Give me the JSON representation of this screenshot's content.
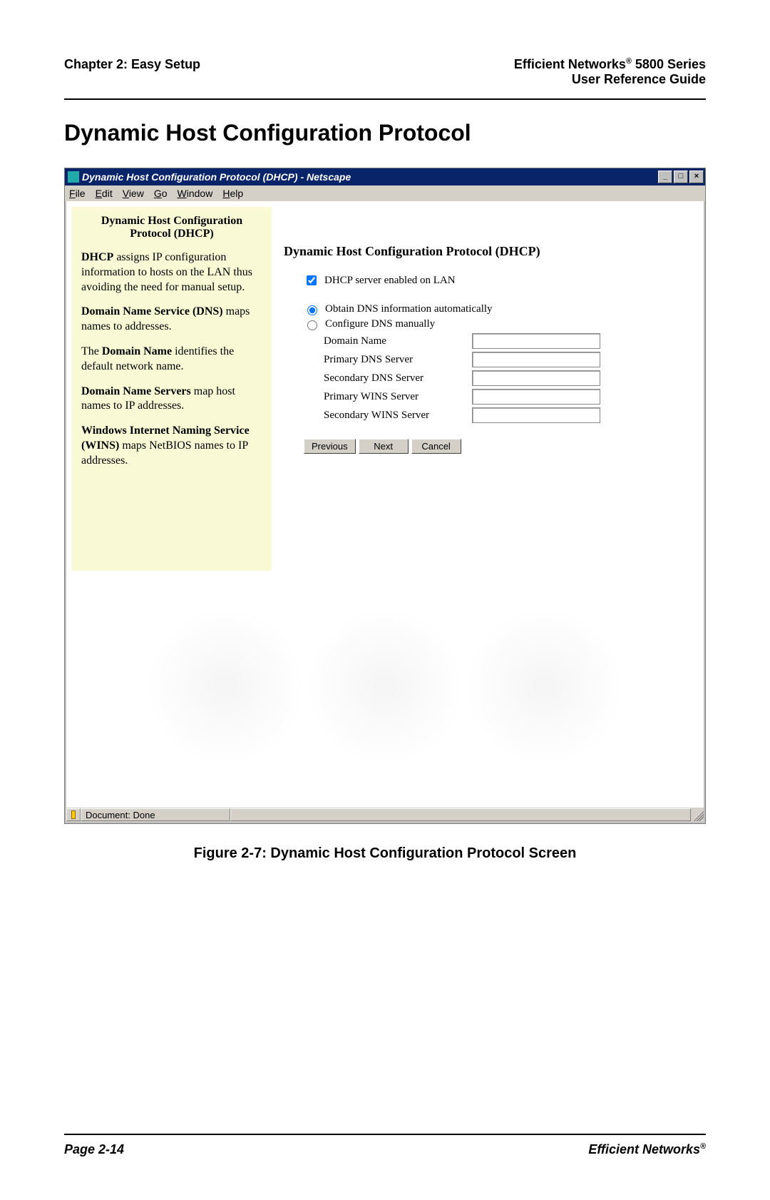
{
  "header": {
    "chapter": "Chapter 2: Easy Setup",
    "product_line1": "Efficient Networks",
    "product_reg": "®",
    "product_series": " 5800 Series",
    "product_line2": "User Reference Guide"
  },
  "section_title": "Dynamic Host Configuration Protocol",
  "window": {
    "title": "Dynamic Host Configuration Protocol (DHCP) - Netscape",
    "menus": {
      "file": "File",
      "edit": "Edit",
      "view": "View",
      "go": "Go",
      "window": "Window",
      "help": "Help"
    },
    "win_min": "_",
    "win_max": "□",
    "win_close": "×"
  },
  "sidebar": {
    "title": "Dynamic Host Configuration Protocol (DHCP)",
    "p1a": "DHCP",
    "p1b": " assigns IP configuration information to hosts on the LAN thus avoiding the need for manual setup.",
    "p2a": "Domain Name Service (DNS)",
    "p2b": " maps names to addresses.",
    "p3a": "The ",
    "p3b": "Domain Name",
    "p3c": " identifies the default network name.",
    "p4a": "Domain Name Servers",
    "p4b": " map host names to IP addresses.",
    "p5a": "Windows Internet Naming Service (WINS)",
    "p5b": " maps NetBIOS names to IP addresses."
  },
  "form": {
    "heading": "Dynamic Host Configuration Protocol (DHCP)",
    "chk_label": "DHCP server enabled on LAN",
    "radio1": "Obtain DNS information automatically",
    "radio2": "Configure DNS manually",
    "domain_name": "Domain Name",
    "primary_dns": "Primary DNS Server",
    "secondary_dns": "Secondary DNS Server",
    "primary_wins": "Primary WINS Server",
    "secondary_wins": "Secondary WINS Server",
    "values": {
      "domain_name": "",
      "primary_dns": "",
      "secondary_dns": "",
      "primary_wins": "",
      "secondary_wins": ""
    },
    "btn_previous": "Previous",
    "btn_next": "Next",
    "btn_cancel": "Cancel"
  },
  "status": {
    "text": "Document: Done"
  },
  "figure_caption": "Figure 2-7:  Dynamic Host Configuration Protocol Screen",
  "footer": {
    "page": "Page 2-14",
    "brand": "Efficient Networks",
    "reg": "®"
  }
}
